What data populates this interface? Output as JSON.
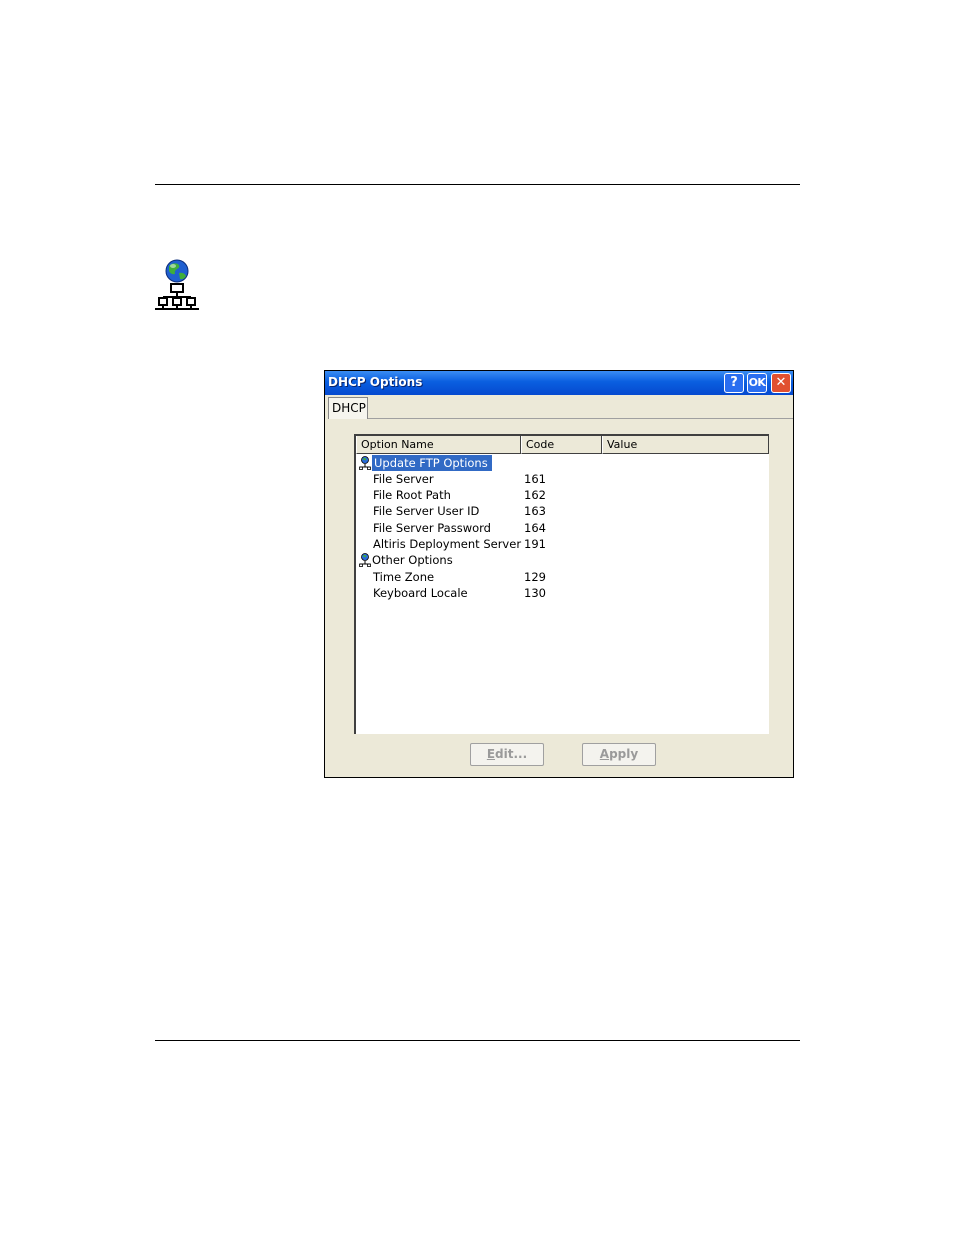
{
  "dialog": {
    "title": "DHCP Options",
    "help_label": "?",
    "ok_label": "OK",
    "close_label": "✕"
  },
  "tabs": [
    {
      "label": "DHCP"
    }
  ],
  "table": {
    "columns": [
      "Option Name",
      "Code",
      "Value"
    ],
    "rows": [
      {
        "name": "Update FTP Options",
        "code": "",
        "group": true,
        "selected": true
      },
      {
        "name": "File Server",
        "code": "161"
      },
      {
        "name": "File Root Path",
        "code": "162"
      },
      {
        "name": "File Server User ID",
        "code": "163"
      },
      {
        "name": "File Server Password",
        "code": "164"
      },
      {
        "name": "Altiris Deployment Server",
        "code": "191"
      },
      {
        "name": "Other Options",
        "code": "",
        "group": true
      },
      {
        "name": "Time Zone",
        "code": "129"
      },
      {
        "name": "Keyboard Locale",
        "code": "130"
      }
    ]
  },
  "buttons": {
    "edit_mnemonic": "E",
    "edit_rest": "dit...",
    "apply_mnemonic": "A",
    "apply_rest": "pply"
  },
  "colors": {
    "titlebar": "#0a5fe0",
    "selection": "#316ac5",
    "dialog_bg": "#ece9d8"
  }
}
